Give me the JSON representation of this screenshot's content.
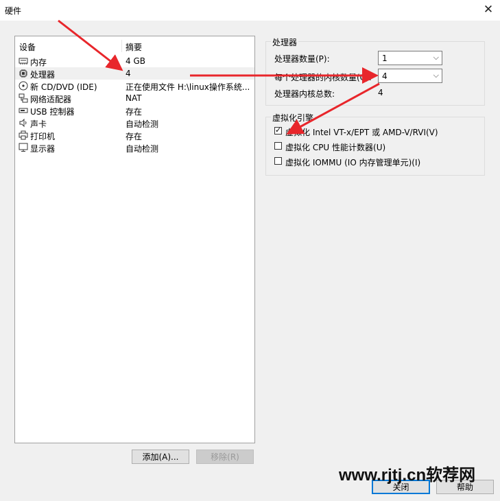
{
  "window": {
    "title": "硬件"
  },
  "device_list": {
    "col_device": "设备",
    "col_summary": "摘要",
    "items": [
      {
        "name": "内存",
        "summary": "4 GB",
        "icon": "memory-icon"
      },
      {
        "name": "处理器",
        "summary": "4",
        "icon": "processor-icon",
        "selected": true
      },
      {
        "name": "新 CD/DVD (IDE)",
        "summary": "正在使用文件 H:\\linux操作系统...",
        "icon": "cd-dvd-icon"
      },
      {
        "name": "网络适配器",
        "summary": "NAT",
        "icon": "network-adapter-icon"
      },
      {
        "name": "USB 控制器",
        "summary": "存在",
        "icon": "usb-icon"
      },
      {
        "name": "声卡",
        "summary": "自动检测",
        "icon": "sound-card-icon"
      },
      {
        "name": "打印机",
        "summary": "存在",
        "icon": "printer-icon"
      },
      {
        "name": "显示器",
        "summary": "自动检测",
        "icon": "display-icon"
      }
    ]
  },
  "buttons": {
    "add": "添加(A)...",
    "remove": "移除(R)",
    "close": "关闭",
    "help": "帮助"
  },
  "processor": {
    "legend": "处理器",
    "count_label": "处理器数量(P):",
    "count_value": "1",
    "cores_label": "每个处理器的内核数量(C):",
    "cores_value": "4",
    "total_label": "处理器内核总数:",
    "total_value": "4"
  },
  "virtualization": {
    "legend": "虚拟化引擎",
    "options": [
      {
        "label": "虚拟化 Intel VT-x/EPT 或 AMD-V/RVI(V)",
        "checked": true
      },
      {
        "label": "虚拟化 CPU 性能计数器(U)",
        "checked": false
      },
      {
        "label": "虚拟化 IOMMU (IO 内存管理单元)(I)",
        "checked": false
      }
    ]
  },
  "watermark": "www.rjtj.cn软荐网",
  "colors": {
    "arrow": "#e8262b",
    "accent": "#0078d7"
  }
}
